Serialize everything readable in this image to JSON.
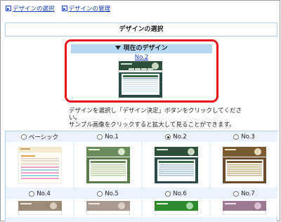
{
  "nav": {
    "select_design": "デザインの選択",
    "manage_design": "デザインの管理"
  },
  "title": "デザインの選択",
  "current": {
    "heading": "現在のデザイン",
    "name": "No.2"
  },
  "instructions": {
    "line1": "デザインを選択し「デザイン決定」ボタンをクリックしてください。",
    "line2": "サンプル画像をクリックすると拡大して見ることができます。"
  },
  "designs": [
    {
      "label": "ベーシック",
      "selected": false,
      "header_color": "#f3ead0",
      "accent": "#f0a0c8"
    },
    {
      "label": "No.1",
      "selected": false,
      "header_color": "#6a8a5a",
      "accent": "#b8cfa0"
    },
    {
      "label": "No.2",
      "selected": true,
      "header_color": "#2e4f3a",
      "accent": "#a8c0d8"
    },
    {
      "label": "No.3",
      "selected": false,
      "header_color": "#7a5a30",
      "accent": "#c8b080"
    },
    {
      "label": "No.4",
      "selected": false,
      "header_color": "#9c8a78",
      "accent": "#d8ccc0"
    },
    {
      "label": "No.5",
      "selected": false,
      "header_color": "#a89a90",
      "accent": "#d8d0c8"
    },
    {
      "label": "No.6",
      "selected": false,
      "header_color": "#2f8a2f",
      "accent": "#a8d8a8"
    },
    {
      "label": "No.7",
      "selected": false,
      "header_color": "#9a7a90",
      "accent": "#d8c0d0"
    }
  ],
  "colors": {
    "highlight_border": "#e8121b",
    "header_band": "#b7d6f0",
    "grid_bg": "#eaf3fb",
    "link": "#1a40c0"
  }
}
